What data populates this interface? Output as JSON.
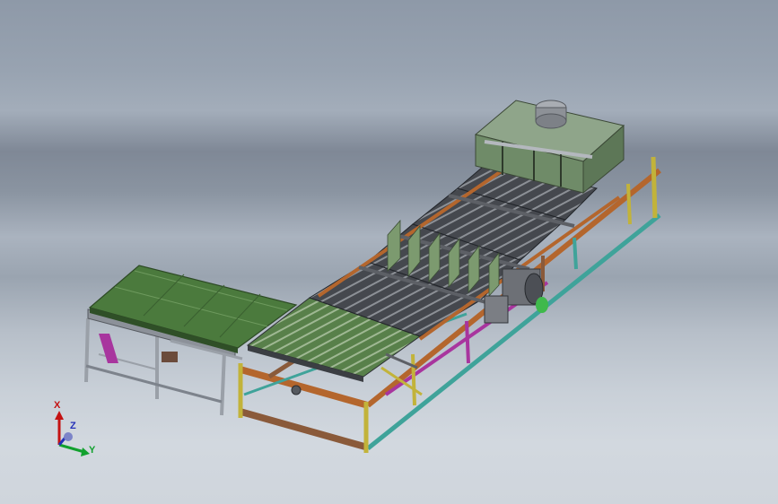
{
  "viewport": {
    "background_top": "#8e99a8",
    "background_bottom": "#cfd5dc"
  },
  "triad": {
    "x_label": "X",
    "y_label": "Y",
    "z_label": "Z",
    "x_color": "#c41212",
    "y_color": "#12a12e",
    "z_color": "#2430b8"
  },
  "colors": {
    "conveyor_green": "#4b7a3d",
    "frame_orange": "#b4662d",
    "frame_brown": "#8a5a3a",
    "frame_yellow": "#c2b33a",
    "frame_magenta": "#a8359e",
    "frame_teal": "#3fa39a",
    "frame_grey": "#8d8f94",
    "roller_dark": "#3c3f44"
  }
}
